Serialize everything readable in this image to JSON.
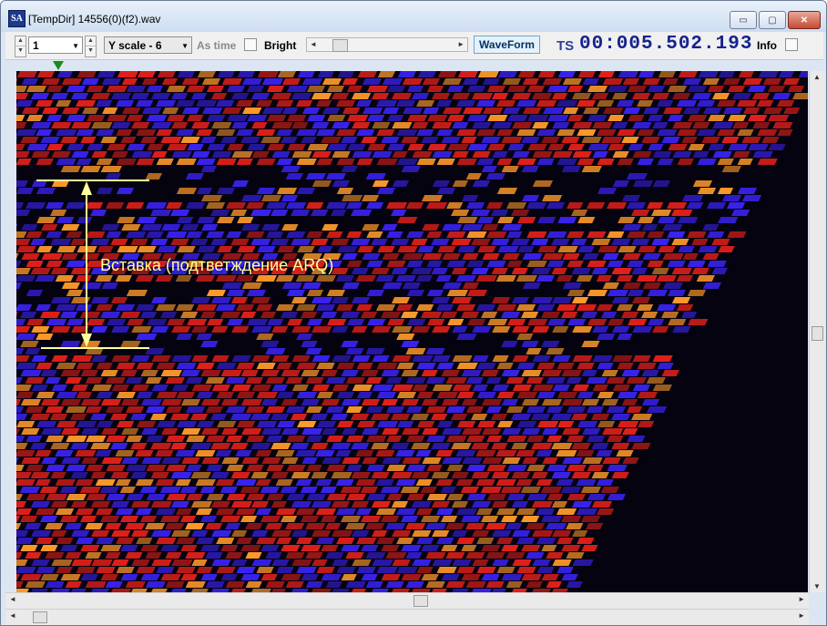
{
  "window": {
    "app_icon": "SA",
    "title": "[TempDir] 14556(0)(f2).wav",
    "buttons": {
      "minimize": "▭",
      "maximize": "▢",
      "close": "✕"
    }
  },
  "toolbar": {
    "channel_value": "1",
    "yscale_value": "Y scale - 6",
    "as_time_label": "As time",
    "bright_label": "Bright",
    "waveform_label": "WaveForm",
    "ts_label": "TS",
    "timecode": "00:005.502.193",
    "info_label": "Info"
  },
  "annotation": {
    "text": "Вставка (подтветждение ARQ)",
    "color": "#ffff99"
  },
  "colors": {
    "spectrogram_bg": "#05030f",
    "red": "#e0201a",
    "blue": "#3a22f0",
    "orange": "#ff9a2a"
  },
  "icons": [
    "app-icon",
    "spin-up-icon",
    "spin-down-icon",
    "dropdown-arrow-icon",
    "scroll-left-icon",
    "scroll-right-icon",
    "scroll-up-icon",
    "scroll-down-icon",
    "position-marker-icon"
  ]
}
